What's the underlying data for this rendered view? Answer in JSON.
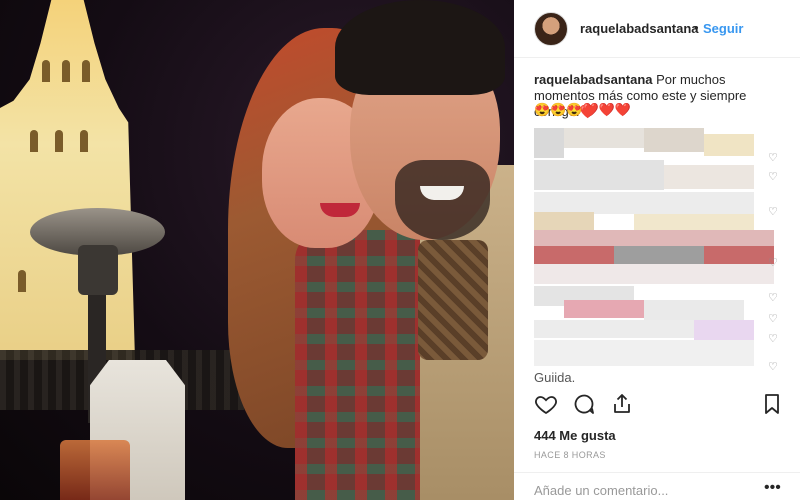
{
  "post": {
    "username": "raquelabadsantana",
    "follow_label": "Seguir",
    "separator": "•",
    "caption_username": "raquelabadsantana",
    "caption_text": "Por muchos momentos más como este y siempre contigo.❤️",
    "caption_emojis": "😍😍😍❤️❤️❤️",
    "comment_fragment": "Guiida.",
    "likes_label": "444 Me gusta",
    "time_label": "HACE 8 HORAS",
    "comment_placeholder": "Añade un comentario...",
    "more_label": "•••"
  },
  "colors": {
    "follow": "#3897f0",
    "text": "#262626",
    "muted": "#999999",
    "border": "#efefef"
  },
  "icons": {
    "like": "heart-icon",
    "comment": "comment-icon",
    "share": "share-icon",
    "save": "bookmark-icon",
    "comment_like": "small-heart-icon"
  }
}
